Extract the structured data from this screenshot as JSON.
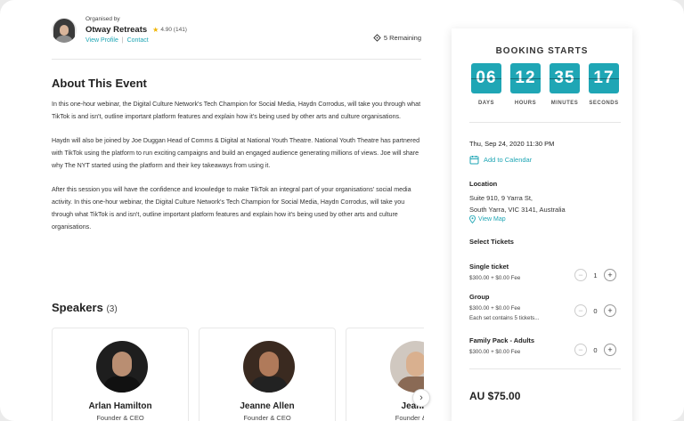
{
  "organiser": {
    "kicker": "Organised by",
    "name": "Otway Retreats",
    "rating": "4.90 (141)",
    "view_profile": "View Profile",
    "separator": "|",
    "contact": "Contact"
  },
  "remaining": "5 Remaining",
  "about": {
    "title": "About This Event",
    "paragraphs": [
      "In this one-hour webinar, the Digital Culture Network's Tech Champion for Social Media, Haydn Corrodus, will take you through what TikTok is and isn't, outline important platform features and explain how it's being used by other arts and culture organisations.",
      "Haydn will also be joined by Joe Duggan Head of Comms & Digital at National Youth Theatre. National Youth Theatre has partnered with TikTok using the platform to run exciting campaigns and build an engaged audience generating millions of views. Joe will share why The NYT started using the platform and their key takeaways from using it.",
      "After this session you will have the confidence and knowledge to make TikTok an integral part of your organisations' social media activity. In this one-hour webinar, the Digital Culture Network's Tech Champion for Social Media, Haydn Corrodus, will take you through what TikTok is and isn't, outline important platform features and explain how it's being used by other arts and culture organisations."
    ]
  },
  "speakers": {
    "title": "Speakers",
    "count": "(3)",
    "items": [
      {
        "name": "Arlan Hamilton",
        "role": "Founder & CEO"
      },
      {
        "name": "Jeanne Allen",
        "role": "Founder & CEO"
      },
      {
        "name": "Jeann",
        "role": "Founder & C"
      }
    ]
  },
  "booking": {
    "title": "BOOKING STARTS",
    "countdown": [
      {
        "value": "06",
        "label": "DAYS"
      },
      {
        "value": "12",
        "label": "HOURS"
      },
      {
        "value": "35",
        "label": "MINUTES"
      },
      {
        "value": "17",
        "label": "SECONDS"
      }
    ],
    "date": "Thu, Sep 24, 2020 11:30 PM",
    "add_calendar": "Add to Calendar",
    "location_label": "Location",
    "address_line1": "Suite 910, 9 Yarra St,",
    "address_line2": "South Yarra, VIC 3141, Australia",
    "view_map": "View Map",
    "select_tickets": "Select Tickets",
    "tickets": [
      {
        "name": "Single ticket",
        "price": "$300.00 + $0.00 Fee",
        "note": "",
        "qty": "1"
      },
      {
        "name": "Group",
        "price": "$300.00 + $0.00 Fee",
        "note": "Each set contains 5 tickets...",
        "qty": "0"
      },
      {
        "name": "Family Pack - Adults",
        "price": "$300.00 + $0.00 Fee",
        "note": "",
        "qty": "0"
      }
    ],
    "total": "AU $75.00"
  },
  "colors": {
    "accent": "#1fa6b5",
    "star": "#f0b400"
  }
}
